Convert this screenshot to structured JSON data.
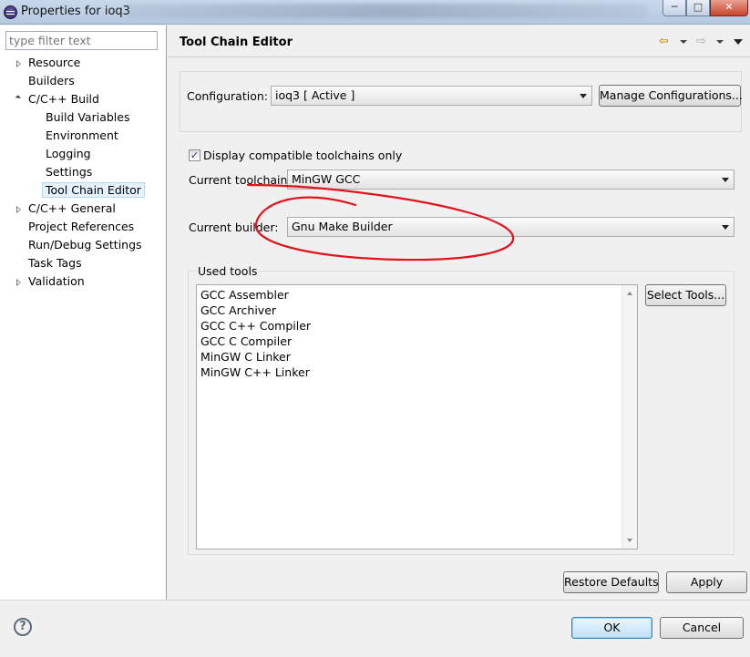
{
  "window": {
    "title": "Properties for ioq3",
    "controls": {
      "minimize": "─",
      "maximize": "□",
      "close": "✕"
    }
  },
  "sidebar": {
    "filter_placeholder": "type filter text",
    "items": [
      {
        "label": "Resource",
        "expandable": true,
        "expanded": false,
        "level": 0
      },
      {
        "label": "Builders",
        "expandable": false,
        "level": 0
      },
      {
        "label": "C/C++ Build",
        "expandable": true,
        "expanded": true,
        "level": 0
      },
      {
        "label": "Build Variables",
        "expandable": false,
        "level": 1
      },
      {
        "label": "Environment",
        "expandable": false,
        "level": 1
      },
      {
        "label": "Logging",
        "expandable": false,
        "level": 1
      },
      {
        "label": "Settings",
        "expandable": false,
        "level": 1
      },
      {
        "label": "Tool Chain Editor",
        "expandable": false,
        "level": 1,
        "selected": true
      },
      {
        "label": "C/C++ General",
        "expandable": true,
        "expanded": false,
        "level": 0
      },
      {
        "label": "Project References",
        "expandable": false,
        "level": 0
      },
      {
        "label": "Run/Debug Settings",
        "expandable": false,
        "level": 0
      },
      {
        "label": "Task Tags",
        "expandable": false,
        "level": 0
      },
      {
        "label": "Validation",
        "expandable": true,
        "expanded": false,
        "level": 0
      }
    ]
  },
  "page": {
    "title": "Tool Chain Editor",
    "nav": {
      "back_icon": "⇦",
      "forward_icon": "⇨"
    },
    "configuration": {
      "label": "Configuration:",
      "value": "ioq3  [ Active ]",
      "manage_button": "Manage Configurations..."
    },
    "display_compatible": {
      "label": "Display compatible toolchains only",
      "checked": true,
      "check_glyph": "✓"
    },
    "current_toolchain": {
      "label": "Current toolchain:",
      "value": "MinGW GCC"
    },
    "current_builder": {
      "label": "Current builder:",
      "value": "Gnu Make Builder"
    },
    "used_tools": {
      "title": "Used tools",
      "items": [
        "GCC Assembler",
        "GCC Archiver",
        "GCC C++ Compiler",
        "GCC C Compiler",
        "MinGW C Linker",
        "MinGW C++ Linker"
      ],
      "select_button": "Select Tools..."
    },
    "restore_defaults_button": "Restore Defaults",
    "apply_button": "Apply"
  },
  "footer": {
    "help_icon": "?",
    "ok_button": "OK",
    "cancel_button": "Cancel"
  },
  "annotation": {
    "color": "#e0141c"
  }
}
